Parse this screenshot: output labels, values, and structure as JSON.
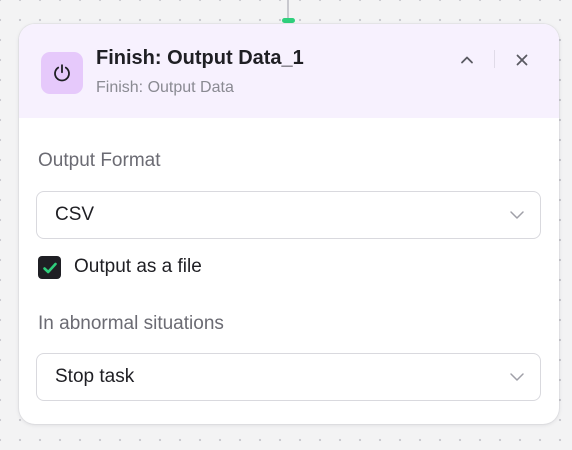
{
  "node": {
    "title": "Finish: Output Data_1",
    "subtitle": "Finish: Output Data",
    "icon": "power-icon",
    "icon_background": "#e6c9fb",
    "header_background": "#f7f1fe",
    "connector_color": "#2fcf7c"
  },
  "fields": {
    "output_format": {
      "label": "Output Format",
      "value": "CSV"
    },
    "output_as_file": {
      "label": "Output as a file",
      "checked": true,
      "check_color": "#2fcf7c"
    },
    "abnormal": {
      "label": "In abnormal situations",
      "value": "Stop task"
    }
  }
}
